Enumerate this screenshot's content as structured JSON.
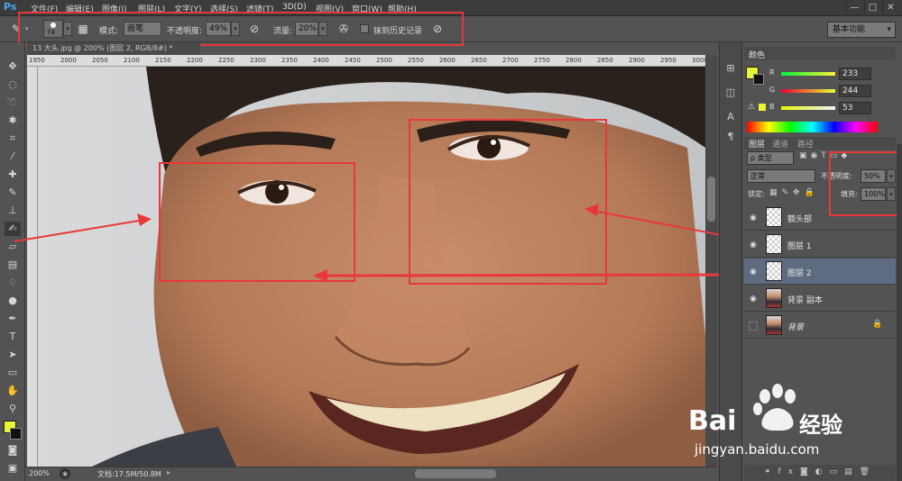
{
  "app": {
    "logo": "Ps"
  },
  "menu": {
    "items": [
      "文件(F)",
      "编辑(E)",
      "图像(I)",
      "图层(L)",
      "文字(Y)",
      "选择(S)",
      "滤镜(T)",
      "3D(D)",
      "视图(V)",
      "窗口(W)",
      "帮助(H)"
    ],
    "window_controls": [
      "—",
      "□",
      "✕"
    ]
  },
  "options": {
    "brush_size": "74",
    "mode_label": "模式:",
    "mode_value": "画笔",
    "opacity_label": "不透明度:",
    "opacity_value": "49%",
    "flow_label": "流量:",
    "flow_value": "20%",
    "history_label": "抹到历史记录",
    "workspace": "基本功能"
  },
  "document": {
    "tab_title": "13 大头.jpg @ 200% (图层 2, RGB/8#) *",
    "ruler_ticks": [
      "1950",
      "2000",
      "2050",
      "2100",
      "2150",
      "2200",
      "2250",
      "2300",
      "2350",
      "2400",
      "2450",
      "2500",
      "2550",
      "2600",
      "2650",
      "2700",
      "2750",
      "2800",
      "2850",
      "2900",
      "2950",
      "3000"
    ],
    "zoom": "200%",
    "doc_size": "文档:17.5M/50.8M"
  },
  "color_panel": {
    "tab": "颜色",
    "channels": [
      {
        "label": "R",
        "value": "233"
      },
      {
        "label": "G",
        "value": "244"
      },
      {
        "label": "B",
        "value": "53"
      }
    ],
    "foreground": "#e9f435",
    "background": "#111111"
  },
  "layers_panel": {
    "tabs": [
      "图层",
      "通道",
      "路径"
    ],
    "filter_label": "ρ 类型",
    "blend_mode": "正常",
    "opacity_label": "不透明度:",
    "opacity_value": "50%",
    "lock_label": "锁定:",
    "fill_label": "填充:",
    "fill_value": "100%",
    "layers": [
      {
        "name": "额头部",
        "visible": true,
        "thumb": "transparent",
        "selected": false
      },
      {
        "name": "图层 1",
        "visible": true,
        "thumb": "transparent",
        "selected": false
      },
      {
        "name": "图层 2",
        "visible": true,
        "thumb": "transparent",
        "selected": true
      },
      {
        "name": "背景 副本",
        "visible": true,
        "thumb": "photo",
        "selected": false
      },
      {
        "name": "背景",
        "visible": false,
        "thumb": "photo",
        "selected": false,
        "locked": true
      }
    ]
  },
  "watermark": {
    "brand": "Bai",
    "brand2": "经验",
    "url": "jingyan.baidu.com"
  }
}
